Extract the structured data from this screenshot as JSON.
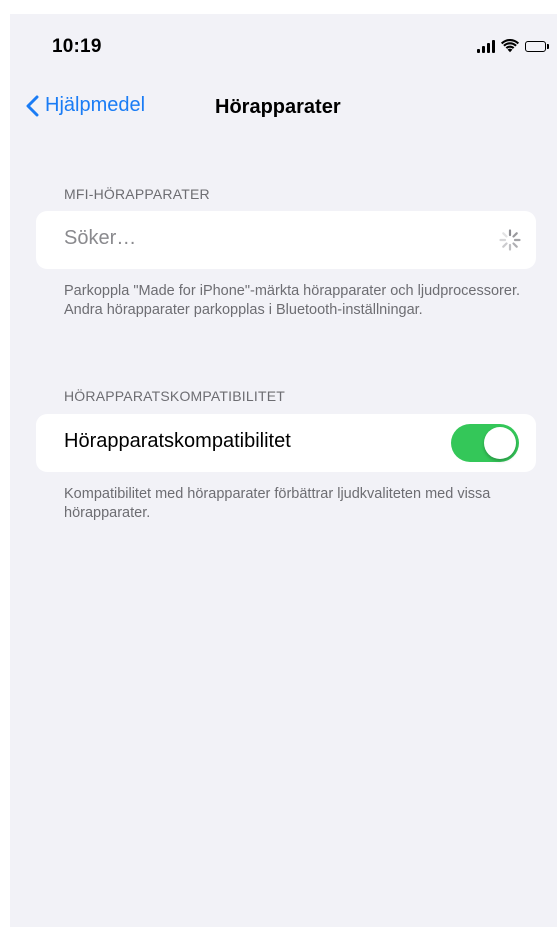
{
  "status_bar": {
    "time": "10:19",
    "icons": [
      "signal-icon",
      "wifi-icon",
      "battery-icon"
    ]
  },
  "nav": {
    "back_label": "Hjälpmedel",
    "back_icon": "chevron-left-icon",
    "title": "Hörapparater"
  },
  "mfi_section": {
    "header": "MFI-HÖRAPPARATER",
    "searching_label": "Söker…",
    "spinner_icon": "activity-spinner-icon",
    "footer": "Parkoppla \"Made for iPhone\"-märkta hörapparater och ljudprocessorer. Andra hörapparater parkopplas i Bluetooth-inställningar."
  },
  "compat_section": {
    "header": "HÖRAPPARATSKOMPATIBILITET",
    "toggle_label": "Hörapparatskompatibilitet",
    "toggle_on": true,
    "footer": "Kompatibilitet med hörapparater förbättrar ljudkvaliteten med vissa hörapparater."
  },
  "colors": {
    "accent": "#1a7cf5",
    "toggle_on": "#34c759",
    "background": "#f2f2f7",
    "secondary_text": "#6d6d72"
  }
}
